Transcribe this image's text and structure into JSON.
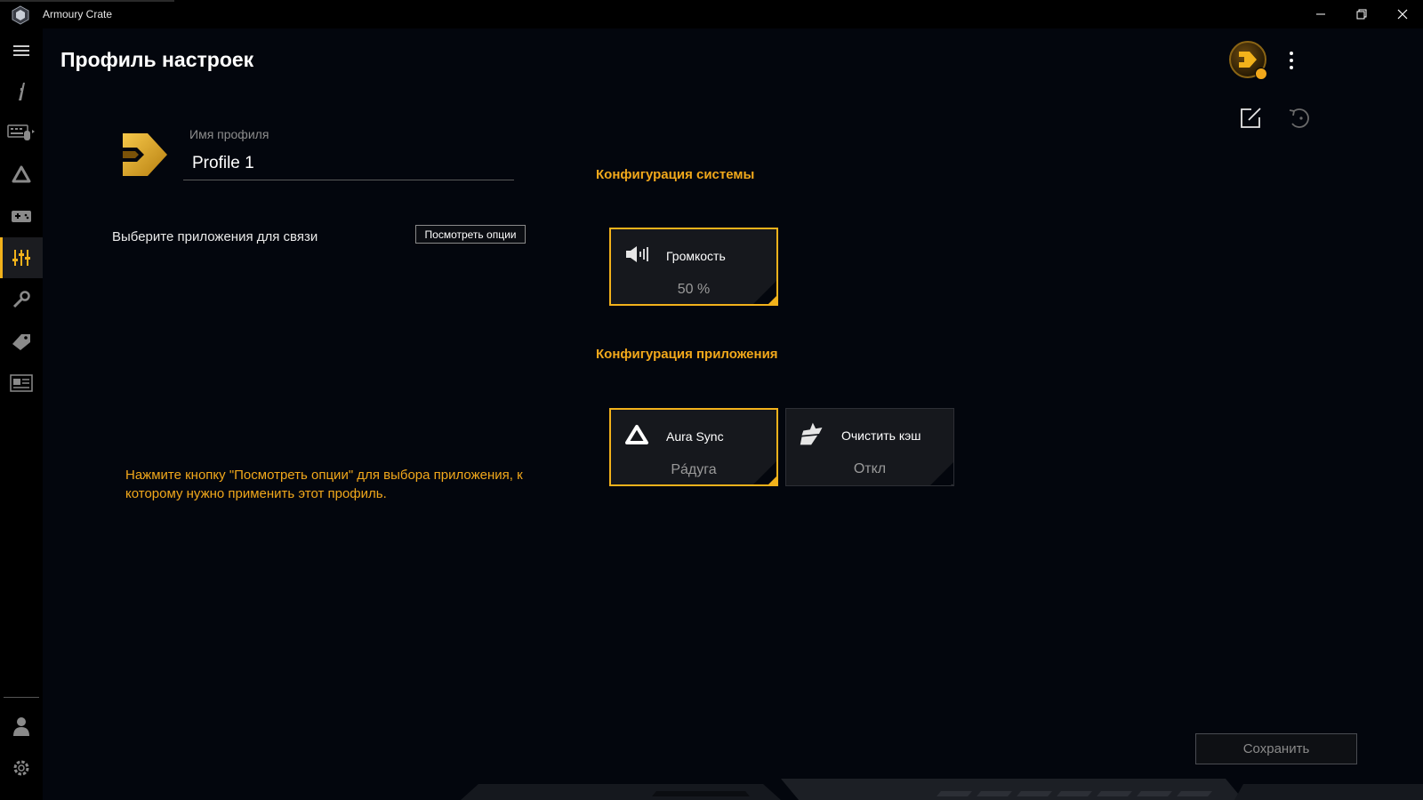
{
  "window": {
    "title": "Armoury Crate"
  },
  "header": {
    "title": "Профиль настроек"
  },
  "profile": {
    "name_label": "Имя профиля",
    "name_value": "Profile 1"
  },
  "link_apps": {
    "label": "Выберите приложения для связи",
    "options_button": "Посмотреть опции"
  },
  "hint": "Нажмите кнопку \"Посмотреть опции\" для выбора приложения, к которому нужно применить этот профиль.",
  "system_config": {
    "title": "Конфигурация системы",
    "cards": [
      {
        "title": "Громкость",
        "value": "50 %",
        "icon": "speaker-icon"
      }
    ]
  },
  "app_config": {
    "title": "Конфигурация приложения",
    "cards": [
      {
        "title": "Aura Sync",
        "value": "Рáдуга",
        "icon": "aura-sync-icon"
      },
      {
        "title": "Очистить кэш",
        "value": "Откл",
        "icon": "clean-cache-icon"
      }
    ]
  },
  "footer": {
    "save_button": "Сохранить"
  },
  "colors": {
    "accent": "#f2b21b",
    "background": "#03060d",
    "card": "#16181d"
  }
}
